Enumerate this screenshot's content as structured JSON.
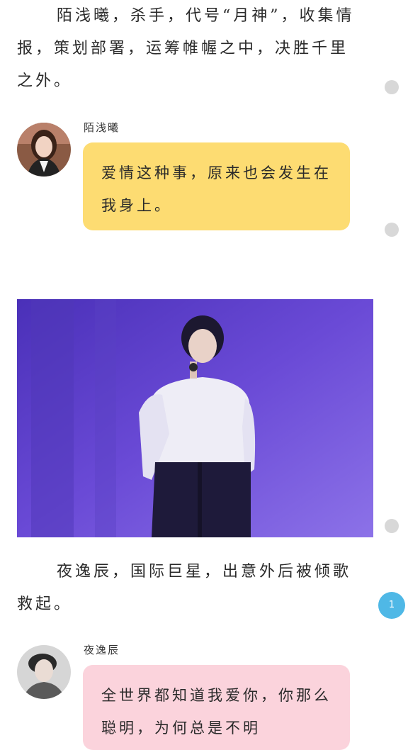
{
  "story": {
    "intro1": "陌浅曦，杀手，代号“月神”，收集情报，策划部署，运筹帷幄之中，决胜千里之外。",
    "intro2": "夜逸辰，国际巨星，出意外后被倾歌救起。"
  },
  "messages": [
    {
      "name": "陌浅曦",
      "text": "爱情这种事，原来也会发生在我身上。",
      "bubble_color": "#fddc72"
    },
    {
      "name": "夜逸辰",
      "text": "全世界都知道我爱你，你那么聪明，为何总是不明",
      "bubble_color": "#fbd3dc"
    }
  ],
  "photo": {
    "icon": "singer-on-stage-photo",
    "stage_color": "#5b3fc8"
  },
  "pager": {
    "current": "1",
    "badge_color": "#4fb8e6"
  },
  "icons": {
    "side_marker": "circle-dot-icon"
  }
}
